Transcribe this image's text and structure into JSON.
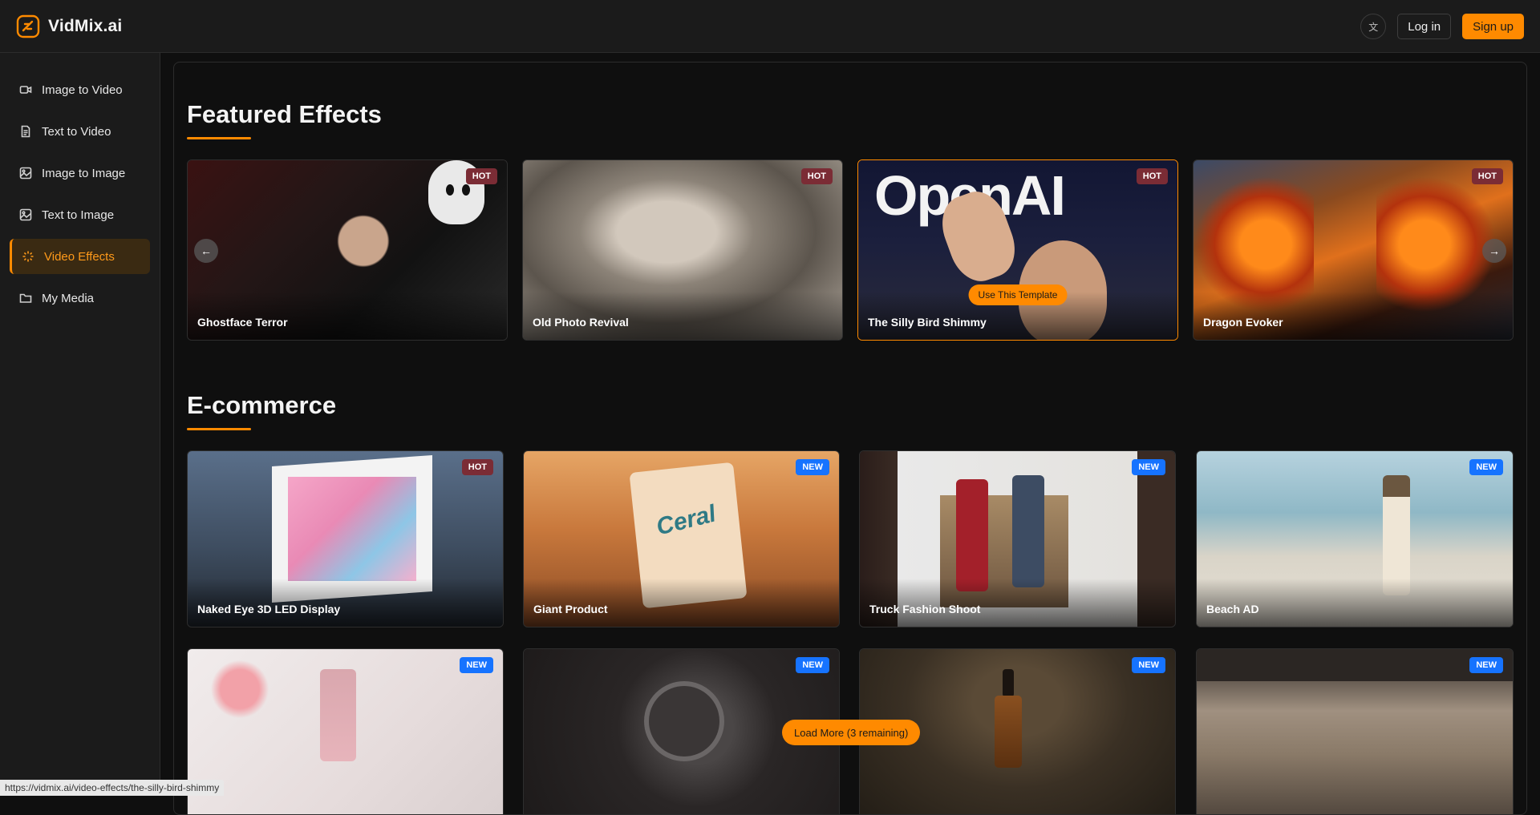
{
  "brand": {
    "name": "VidMix.ai"
  },
  "header": {
    "login_label": "Log in",
    "signup_label": "Sign up",
    "lang_icon": "translate-icon"
  },
  "sidebar": {
    "items": [
      {
        "label": "Image to Video",
        "icon": "video-camera-icon"
      },
      {
        "label": "Text to Video",
        "icon": "document-icon"
      },
      {
        "label": "Image to Image",
        "icon": "image-edit-icon"
      },
      {
        "label": "Text to Image",
        "icon": "image-icon"
      },
      {
        "label": "Video Effects",
        "icon": "sparkle-icon",
        "active": true
      },
      {
        "label": "My Media",
        "icon": "folder-icon"
      }
    ]
  },
  "featured": {
    "title": "Featured Effects",
    "cards": [
      {
        "title": "Ghostface Terror",
        "badge": "HOT"
      },
      {
        "title": "Old Photo Revival",
        "badge": "HOT"
      },
      {
        "title": "The Silly Bird Shimmy",
        "badge": "HOT",
        "cta": "Use This Template"
      },
      {
        "title": "Dragon Evoker",
        "badge": "HOT"
      }
    ]
  },
  "ecommerce": {
    "title": "E-commerce",
    "cards": [
      {
        "title": "Naked Eye 3D LED Display",
        "badge": "HOT"
      },
      {
        "title": "Giant Product",
        "badge": "NEW"
      },
      {
        "title": "Truck Fashion Shoot",
        "badge": "NEW"
      },
      {
        "title": "Beach AD",
        "badge": "NEW"
      },
      {
        "title": "",
        "badge": "NEW"
      },
      {
        "title": "",
        "badge": "NEW"
      },
      {
        "title": "",
        "badge": "NEW"
      },
      {
        "title": "",
        "badge": "NEW"
      }
    ]
  },
  "load_more_label": "Load More (3 remaining)",
  "status_url": "https://vidmix.ai/video-effects/the-silly-bird-shimmy",
  "colors": {
    "accent": "#ff8a00",
    "hot_badge": "#7b2c35",
    "new_badge": "#1673ff",
    "background": "#0f0f0f",
    "panel": "#1b1b1b"
  }
}
